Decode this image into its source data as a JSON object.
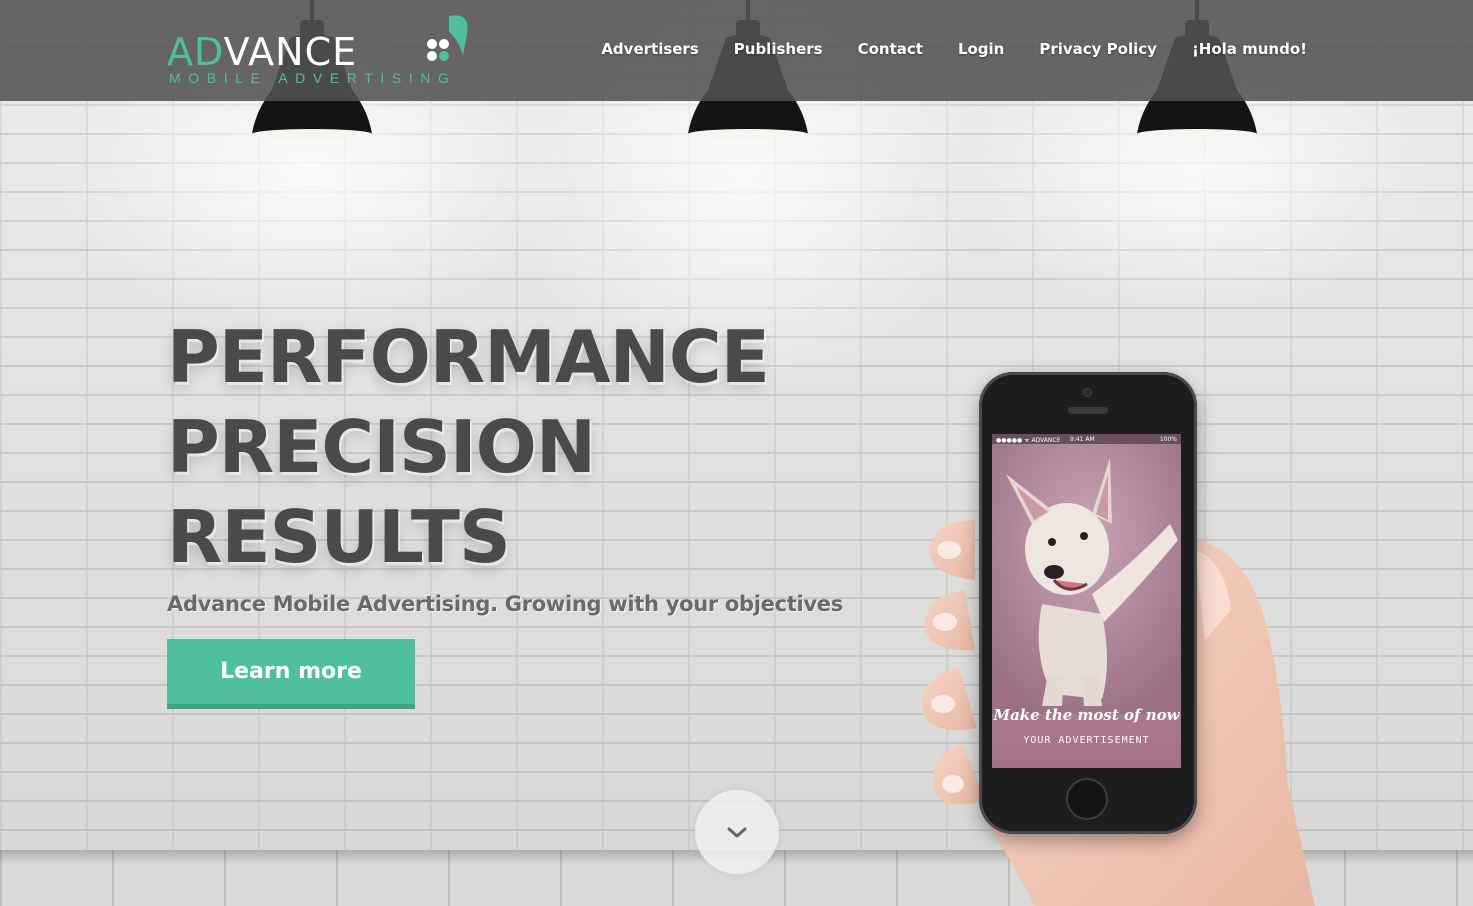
{
  "brand": {
    "name_part_accent": "AD",
    "name_part_rest": "VANCE",
    "tagline": "MOBILE ADVERTISING",
    "accent_color": "#4fbf9f"
  },
  "nav": {
    "items": [
      {
        "label": "Advertisers"
      },
      {
        "label": "Publishers"
      },
      {
        "label": "Contact"
      },
      {
        "label": "Login"
      },
      {
        "label": "Privacy Policy"
      },
      {
        "label": "¡Hola mundo!"
      }
    ]
  },
  "hero": {
    "headline_lines": [
      "PERFORMANCE",
      "PRECISION",
      "RESULTS"
    ],
    "subline": "Advance Mobile Advertising. Growing with your objectives",
    "cta_label": "Learn more",
    "scroll_icon": "chevron-down-icon"
  },
  "phone": {
    "status": {
      "carrier": "●●●●● ᯤ ADVANCE",
      "time": "9:41 AM",
      "battery": "100%"
    },
    "ad_title": "Make the most of now",
    "ad_subtitle": "YOUR ADVERTISEMENT"
  }
}
